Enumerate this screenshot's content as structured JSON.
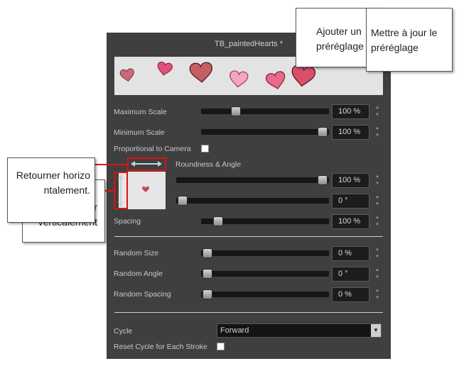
{
  "panel": {
    "title": "TB_paintedHearts *",
    "colors": {
      "background": "#3f3f3f",
      "accent_red": "#e01010"
    }
  },
  "scale": {
    "maximum": {
      "label": "Maximum Scale",
      "value": "100 %",
      "level": 0.2
    },
    "minimum": {
      "label": "Minimum Scale",
      "value": "100 %",
      "level": 1.0
    }
  },
  "proportional": {
    "label": "Proportional to Camera",
    "checked": false
  },
  "roundness": {
    "label": "Roundness & Angle",
    "roundness_value": "100 %",
    "roundness_level": 1.0,
    "angle_value": "0 °",
    "angle_level": 0.0
  },
  "spacing": {
    "label": "Spacing",
    "value": "100 %",
    "level": 0.1
  },
  "random": {
    "size": {
      "label": "Random Size",
      "value": "0 %",
      "level": 0.0
    },
    "angle": {
      "label": "Random Angle",
      "value": "0 °",
      "level": 0.0
    },
    "spacing": {
      "label": "Random Spacing",
      "value": "0 %",
      "level": 0.0
    }
  },
  "cycle": {
    "label": "Cycle",
    "value": "Forward"
  },
  "reset_cycle": {
    "label": "Reset Cycle for Each Stroke",
    "checked": false
  },
  "callouts": {
    "add_preset": "Ajouter un préréglage",
    "update_preset": "Mettre à jour le préréglage",
    "flip_horizontal": "Retourner horizontalement.",
    "flip_vertical": "Retourner verticalement"
  },
  "icons": [
    "heart-icon",
    "flip-horizontal-icon",
    "flip-vertical-icon",
    "chevron-down-icon",
    "spin-up-icon",
    "spin-down-icon"
  ]
}
